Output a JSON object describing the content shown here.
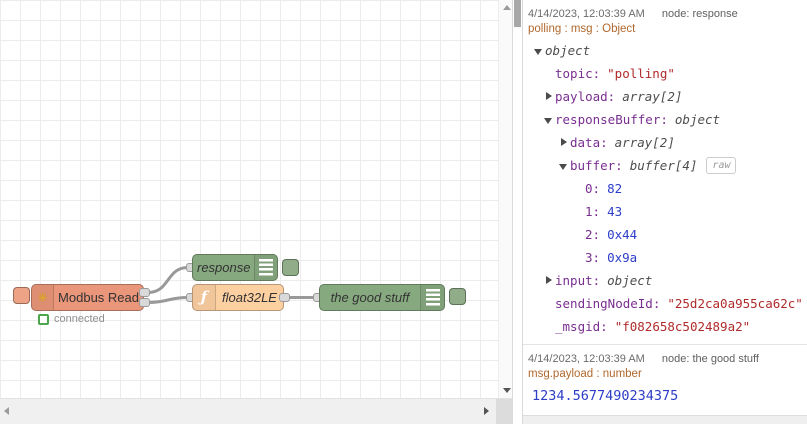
{
  "flow": {
    "modbus_node": {
      "label": "Modbus Read",
      "status": "connected"
    },
    "response_node": {
      "label": "response"
    },
    "function_node": {
      "label": "float32LE"
    },
    "output_node": {
      "label": "the good stuff"
    }
  },
  "icons": {
    "modbus_gear": "✳",
    "function_f": "ƒ"
  },
  "colors": {
    "modbus_node": "#e9967a",
    "debug_node": "#87a980",
    "function_node": "#fdd0a2",
    "wire": "#999999",
    "tree_key": "#792e90",
    "tree_string": "#b02b2b",
    "tree_number": "#2c3dc8",
    "meta_text": "#b0682e"
  },
  "debug_panel": {
    "messages": [
      {
        "timestamp": "4/14/2023, 12:03:39 AM",
        "source": "node: response",
        "meta": "polling : msg : Object",
        "tree": [
          {
            "type": "object"
          },
          {
            "key": "topic:",
            "string": "\"polling\""
          },
          {
            "key": "payload:",
            "type": "array[2]"
          },
          {
            "key": "responseBuffer:",
            "type": "object"
          },
          {
            "key": "data:",
            "type": "array[2]"
          },
          {
            "key": "buffer:",
            "type": "buffer[4]",
            "badge": "raw"
          },
          {
            "key": "0:",
            "number": "82"
          },
          {
            "key": "1:",
            "number": "43"
          },
          {
            "key": "2:",
            "number": "0x44"
          },
          {
            "key": "3:",
            "number": "0x9a"
          },
          {
            "key": "input:",
            "type": "object"
          },
          {
            "key": "sendingNodeId:",
            "string": "\"25d2ca0a955ca62c\""
          },
          {
            "key": "_msgid:",
            "string": "\"f082658c502489a2\""
          }
        ]
      },
      {
        "timestamp": "4/14/2023, 12:03:39 AM",
        "source": "node: the good stuff",
        "meta": "msg.payload : number",
        "value": "1234.5677490234375"
      }
    ]
  }
}
